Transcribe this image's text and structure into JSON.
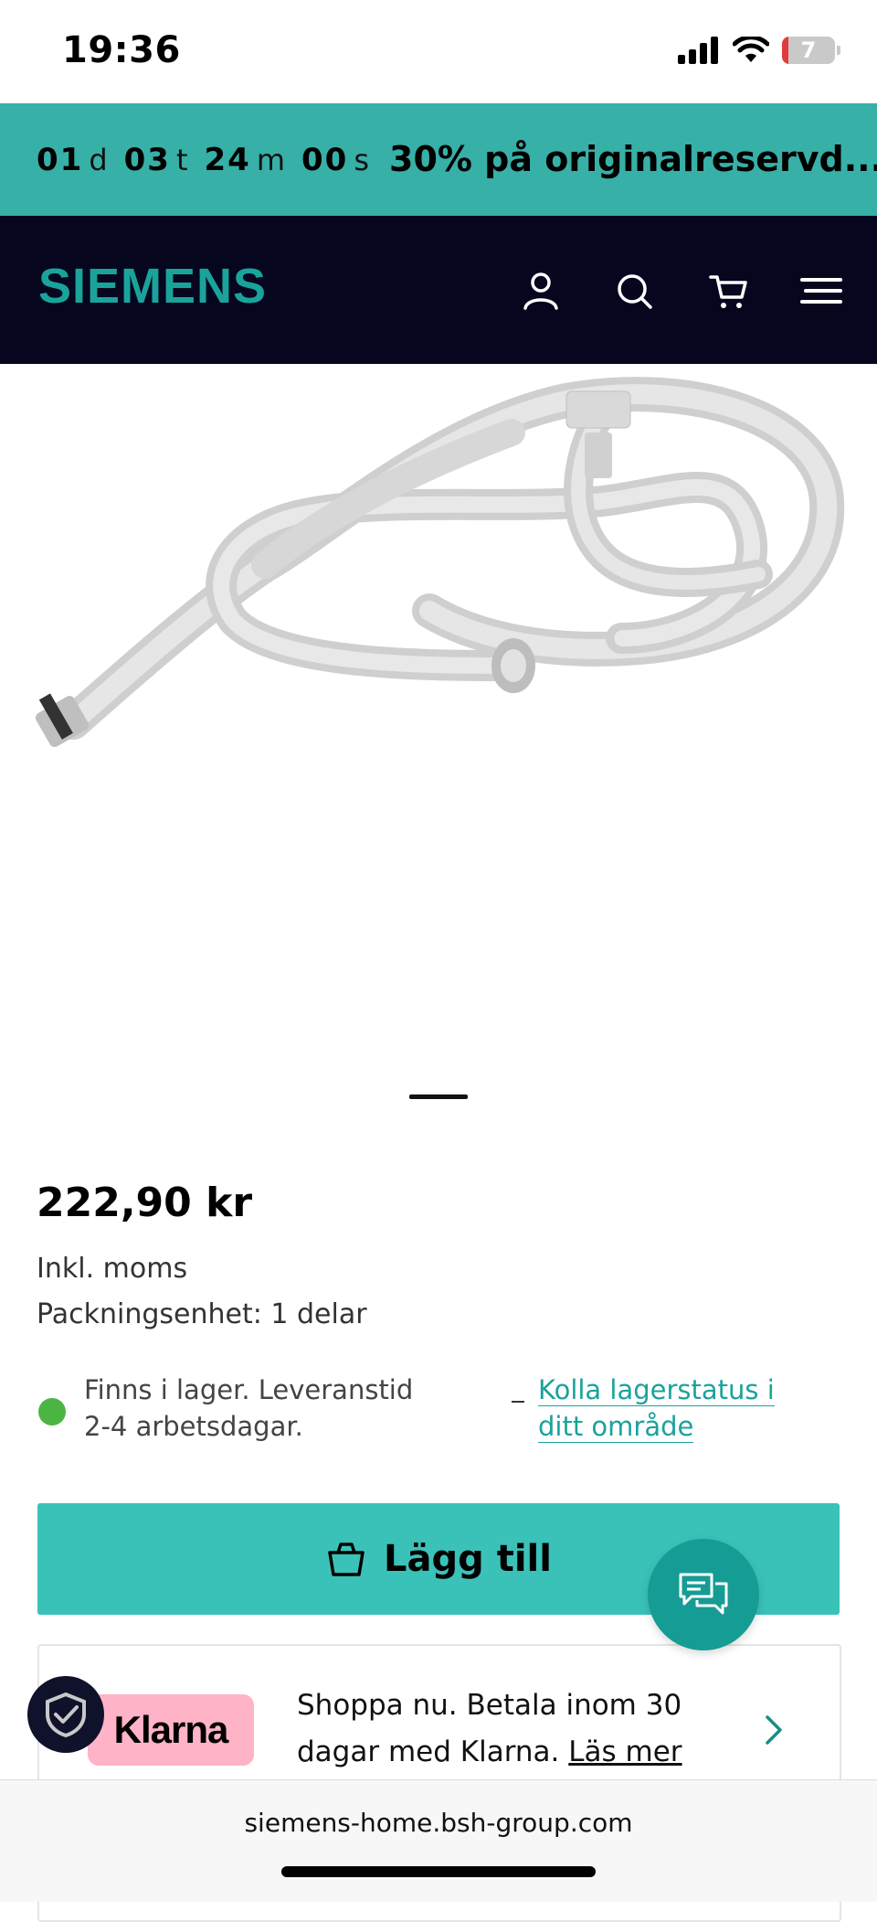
{
  "status_bar": {
    "time": "19:36",
    "battery": "7",
    "icons": [
      "signal-icon",
      "wifi-icon",
      "battery-icon"
    ]
  },
  "promo": {
    "countdown": [
      {
        "value": "01",
        "unit": "d"
      },
      {
        "value": "03",
        "unit": "t"
      },
      {
        "value": "24",
        "unit": "m"
      },
      {
        "value": "00",
        "unit": "s"
      }
    ],
    "text": "30% på originalreservd..."
  },
  "nav": {
    "logo": "SIEMENS",
    "icons": [
      "user-icon",
      "search-icon",
      "cart-icon",
      "menu-icon"
    ]
  },
  "product": {
    "image_alt": "drain-hose-image",
    "price": "222,90 kr",
    "vat": "Inkl. moms",
    "packaging": "Packningsenhet: 1 delar",
    "stock_text": "Finns i lager. Leveranstid 2-4 arbetsdagar.",
    "stock_link": "Kolla lagerstatus i ditt område",
    "add_button": "Lägg till"
  },
  "klarna": {
    "logo": "Klarna",
    "text": "Shoppa nu. Betala inom 30 dagar med Klarna.",
    "link": "Läs mer"
  },
  "browser": {
    "url": "siemens-home.bsh-group.com"
  },
  "colors": {
    "teal": "#37b0a7",
    "nav_bg": "#06071f",
    "logo": "#1aa39b",
    "button": "#3ac2b8",
    "chat": "#159c94",
    "stock_green": "#4bb543",
    "klarna_pink": "#ffb3c7"
  }
}
